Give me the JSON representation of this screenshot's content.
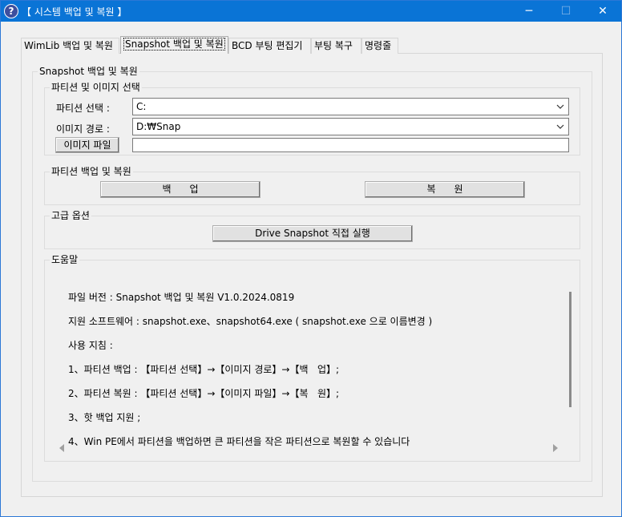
{
  "window": {
    "title": "【 시스템 백업 및 복원 】",
    "icon": "question-icon",
    "controls": {
      "minimize": "─",
      "maximize": "☐",
      "close": "✕"
    }
  },
  "tabs": [
    {
      "label": "WimLib 백업 및 복원",
      "active": false
    },
    {
      "label": "Snapshot 백업 및 복원",
      "active": true
    },
    {
      "label": "BCD 부팅 편집기",
      "active": false
    },
    {
      "label": "부팅 복구",
      "active": false
    },
    {
      "label": "명령줄",
      "active": false
    }
  ],
  "main": {
    "group_title": "Snapshot 백업 및 복원",
    "select_group": {
      "title": "파티션 및 이미지 선택",
      "partition_label": "파티션 선택 :",
      "partition_value": "C:",
      "image_path_label": "이미지 경로 :",
      "image_path_value": "D:₩Snap",
      "image_file_button": "이미지 파일",
      "image_file_value": ""
    },
    "backup_group": {
      "title": "파티션 백업 및 복원",
      "backup_button": "백      업",
      "restore_button": "복      원"
    },
    "advanced_group": {
      "title": "고급 옵션",
      "run_button": "Drive Snapshot 직접 실행"
    },
    "help_group": {
      "title": "도움말",
      "lines": [
        "파일 버전 : Snapshot 백업 및 복원 V1.0.2024.0819",
        "지원 소프트웨어 : snapshot.exe、snapshot64.exe ( snapshot.exe 으로 이름변경 )",
        "사용 지침 :",
        "1、파티션 백업 : 【파티션 선택】→【이미지 경로】→【백   업】;",
        "2、파티션 복원 : 【파티션 선택】→【이미지 파일】→【복   원】;",
        "3、핫 백업 지원 ;",
        "4、Win PE에서 파티션을 백업하면 큰 파티션을 작은 파티션으로 복원할 수 있습니다"
      ]
    }
  }
}
